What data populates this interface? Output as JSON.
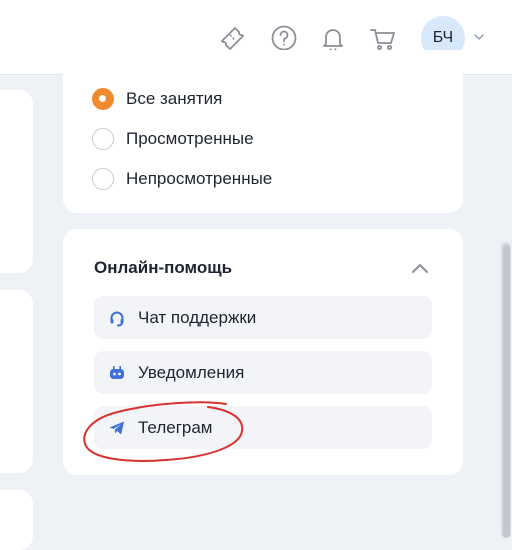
{
  "header": {
    "icons": [
      "ticket-icon",
      "help-icon",
      "bell-icon",
      "cart-icon"
    ],
    "avatar_initials": "БЧ"
  },
  "filters": {
    "options": [
      {
        "label": "Все занятия",
        "checked": true
      },
      {
        "label": "Просмотренные",
        "checked": false
      },
      {
        "label": "Непросмотренные",
        "checked": false
      }
    ]
  },
  "help": {
    "title": "Онлайн-помощь",
    "items": [
      {
        "label": "Чат поддержки",
        "icon": "headset-icon"
      },
      {
        "label": "Уведомления",
        "icon": "bot-icon"
      },
      {
        "label": "Телеграм",
        "icon": "telegram-icon"
      }
    ]
  },
  "colors": {
    "accent": "#f08a2e",
    "icon_blue": "#3f6fd8",
    "annotation_red": "#d8332f",
    "avatar_bg": "#d7e8fa"
  }
}
